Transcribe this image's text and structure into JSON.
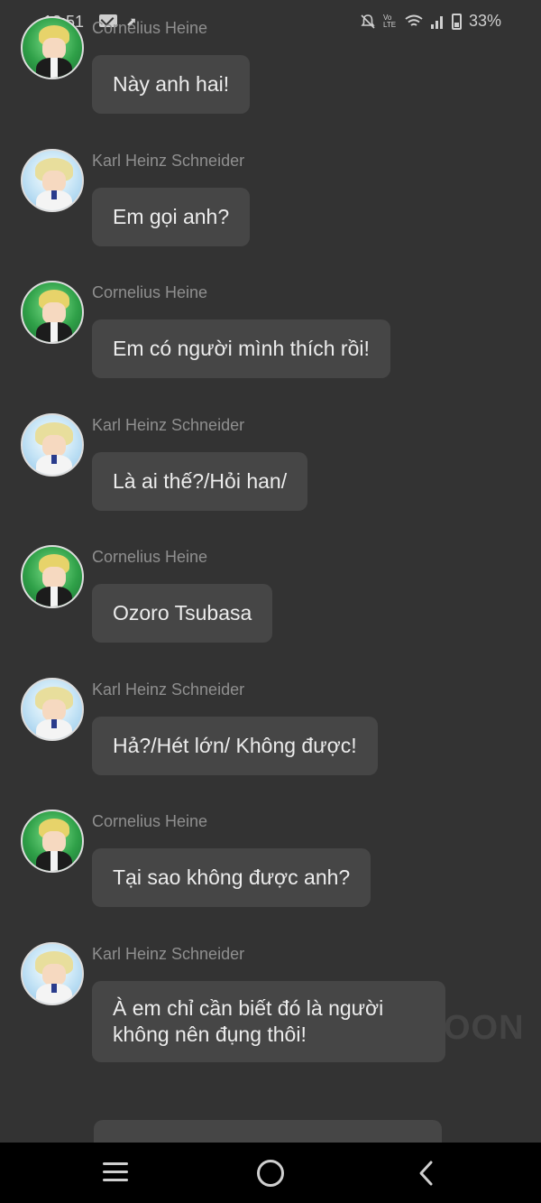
{
  "status_bar": {
    "time": "18:51",
    "battery": "33%",
    "network_label": "Vo LTE",
    "icons": [
      "mail-icon",
      "upload-arrow-icon",
      "bell-muted-icon",
      "wifi-icon",
      "signal-icon",
      "battery-icon"
    ]
  },
  "chat": {
    "messages": [
      {
        "sender": "Cornelius Heine",
        "text": "Này anh hai!",
        "avatar": "avatar-cornelius"
      },
      {
        "sender": "Karl Heinz Schneider",
        "text": "Em gọi anh?",
        "avatar": "avatar-karl"
      },
      {
        "sender": "Cornelius Heine",
        "text": "Em có người mình thích rồi!",
        "avatar": "avatar-cornelius"
      },
      {
        "sender": "Karl Heinz Schneider",
        "text": "Là ai thế?/Hỏi han/",
        "avatar": "avatar-karl"
      },
      {
        "sender": "Cornelius Heine",
        "text": "Ozoro Tsubasa",
        "avatar": "avatar-cornelius"
      },
      {
        "sender": "Karl Heinz Schneider",
        "text": "Hả?/Hét lớn/ Không được!",
        "avatar": "avatar-karl"
      },
      {
        "sender": "Cornelius Heine",
        "text": "Tại sao không được anh?",
        "avatar": "avatar-cornelius"
      },
      {
        "sender": "Karl Heinz Schneider",
        "text": "À em chỉ cần biết đó là người không nên đụng thôi!",
        "avatar": "avatar-karl"
      }
    ],
    "watermark": "OON"
  },
  "nav_bar": {
    "icons": [
      "recent-apps-icon",
      "home-icon",
      "back-icon"
    ]
  },
  "colors": {
    "background": "#333333",
    "bubble": "#464646",
    "name_text": "#8f8f8f",
    "message_text": "#ececec",
    "nav_background": "#000000"
  }
}
